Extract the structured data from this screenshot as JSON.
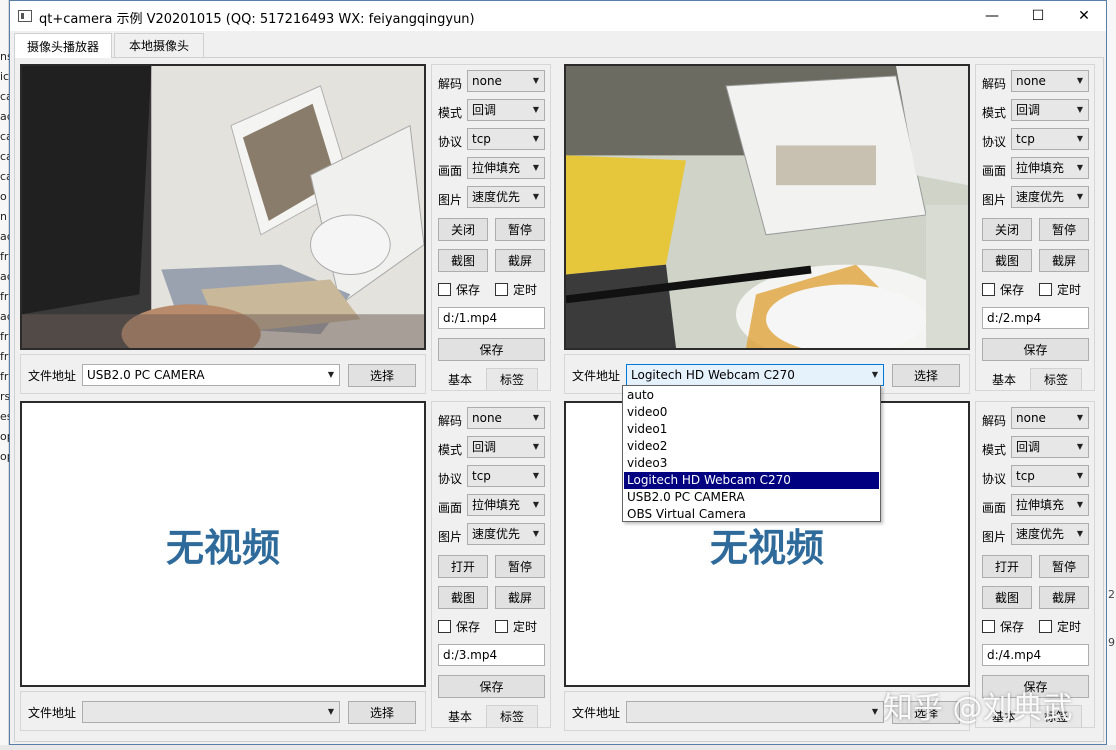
{
  "window": {
    "title": "qt+camera 示例 V20201015 (QQ: 517216493 WX: feiyangqingyun)",
    "minimize_glyph": "—",
    "maximize_glyph": "☐",
    "close_glyph": "✕"
  },
  "tabs": [
    "摄像头播放器",
    "本地摄像头"
  ],
  "background_fragments": {
    "left": [
      "ns",
      "ic",
      "ca",
      "ac",
      "ca",
      "ca",
      "ca",
      "o",
      "n",
      "ac",
      "fr",
      "ac",
      "fr",
      "ac",
      "fr",
      "fr",
      "fr",
      "rs",
      "es",
      "op",
      "op"
    ],
    "right": [
      "2",
      "9"
    ]
  },
  "labels": {
    "decode": "解码",
    "mode": "模式",
    "protocol": "协议",
    "picture": "画面",
    "image": "图片",
    "close": "关闭",
    "open": "打开",
    "pause": "暂停",
    "snapshot": "截图",
    "screenshot": "截屏",
    "save": "保存",
    "timer": "定时",
    "save_button": "保存",
    "basic_tab": "基本",
    "tags_tab": "标签",
    "file_address": "文件地址",
    "choose": "选择",
    "no_video": "无视频"
  },
  "players": [
    {
      "decode": "none",
      "mode": "回调",
      "protocol": "tcp",
      "picture": "拉伸填充",
      "image": "速度优先",
      "toggle_label": "关闭",
      "save_path": "d:/1.mp4",
      "file_source": "USB2.0 PC CAMERA",
      "has_video": true
    },
    {
      "decode": "none",
      "mode": "回调",
      "protocol": "tcp",
      "picture": "拉伸填充",
      "image": "速度优先",
      "toggle_label": "关闭",
      "save_path": "d:/2.mp4",
      "file_source": "Logitech HD Webcam C270",
      "has_video": true
    },
    {
      "decode": "none",
      "mode": "回调",
      "protocol": "tcp",
      "picture": "拉伸填充",
      "image": "速度优先",
      "toggle_label": "打开",
      "save_path": "d:/3.mp4",
      "file_source": "",
      "has_video": false
    },
    {
      "decode": "none",
      "mode": "回调",
      "protocol": "tcp",
      "picture": "拉伸填充",
      "image": "速度优先",
      "toggle_label": "打开",
      "save_path": "d:/4.mp4",
      "file_source": "",
      "has_video": false
    }
  ],
  "dropdown": {
    "items": [
      "auto",
      "video0",
      "video1",
      "video2",
      "video3",
      "Logitech HD Webcam C270",
      "USB2.0 PC CAMERA",
      "OBS Virtual Camera"
    ],
    "selected_index": 5
  },
  "watermark": "知乎 @刘典武",
  "colors": {
    "no_video_text": "#2e6a9a",
    "dropdown_selection": "#000080",
    "window_bg": "#f0f0f0"
  }
}
